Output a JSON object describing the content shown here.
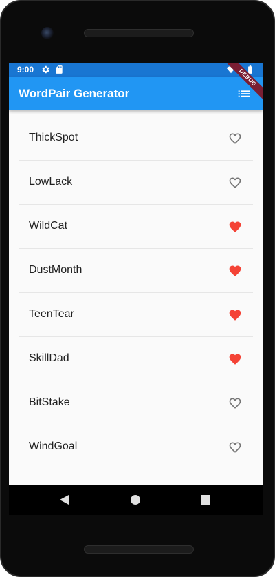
{
  "status_bar": {
    "time": "9:00",
    "icons": [
      "settings-gear-icon",
      "sd-card-icon",
      "wifi-icon",
      "battery-icon"
    ]
  },
  "app_bar": {
    "title": "WordPair Generator",
    "action_icon": "list-icon",
    "color": "#2196f3"
  },
  "debug_banner": {
    "text": "DEBUG"
  },
  "word_list": {
    "items": [
      {
        "word": "ThickSpot",
        "favorited": false
      },
      {
        "word": "LowLack",
        "favorited": false
      },
      {
        "word": "WildCat",
        "favorited": true
      },
      {
        "word": "DustMonth",
        "favorited": true
      },
      {
        "word": "TeenTear",
        "favorited": true
      },
      {
        "word": "SkillDad",
        "favorited": true
      },
      {
        "word": "BitStake",
        "favorited": false
      },
      {
        "word": "WindGoal",
        "favorited": false
      }
    ],
    "favorite_color": "#f44336",
    "unfavorited_color": "#757575"
  },
  "nav_bar": {
    "buttons": [
      "back-icon",
      "home-icon",
      "recents-icon"
    ]
  }
}
